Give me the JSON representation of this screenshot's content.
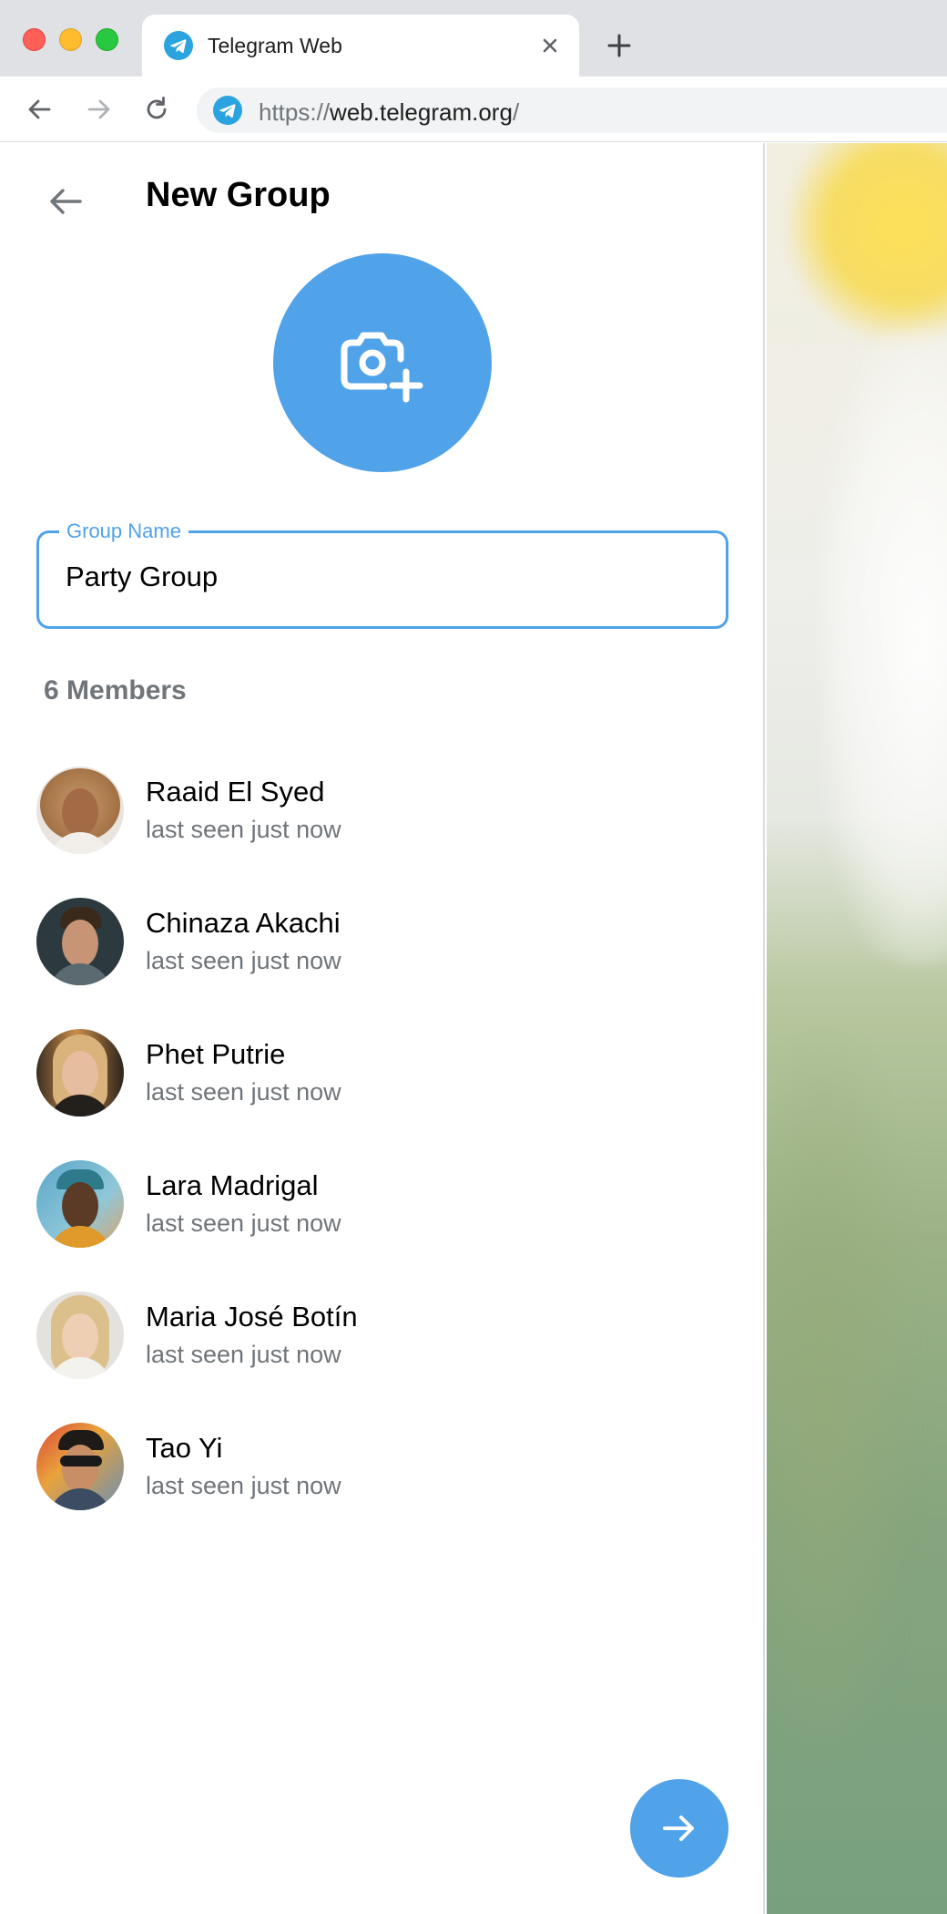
{
  "browser": {
    "tab_title": "Telegram Web",
    "url_scheme": "https://",
    "url_host": "web.telegram.org",
    "url_path": "/",
    "icons": {
      "close": "close-icon",
      "new_tab": "plus-icon",
      "back": "arrow-left-icon",
      "forward": "arrow-right-icon",
      "reload": "reload-icon",
      "favicon": "telegram-logo-icon"
    }
  },
  "header": {
    "title": "New Group",
    "back_icon": "arrow-left-icon"
  },
  "photo": {
    "icon": "camera-add-icon",
    "color": "#50a2e9"
  },
  "group_name": {
    "label": "Group Name",
    "value": "Party Group"
  },
  "members_section": {
    "count_label": "6 Members"
  },
  "members": [
    {
      "name": "Raaid El Syed",
      "status": "last seen just now"
    },
    {
      "name": "Chinaza Akachi",
      "status": "last seen just now"
    },
    {
      "name": "Phet Putrie",
      "status": "last seen just now"
    },
    {
      "name": "Lara Madrigal",
      "status": "last seen just now"
    },
    {
      "name": "Maria José Botín",
      "status": "last seen just now"
    },
    {
      "name": "Tao Yi",
      "status": "last seen just now"
    }
  ],
  "next_button": {
    "icon": "arrow-right-icon"
  },
  "colors": {
    "accent": "#50a2e9",
    "secondary_text": "#707579"
  }
}
